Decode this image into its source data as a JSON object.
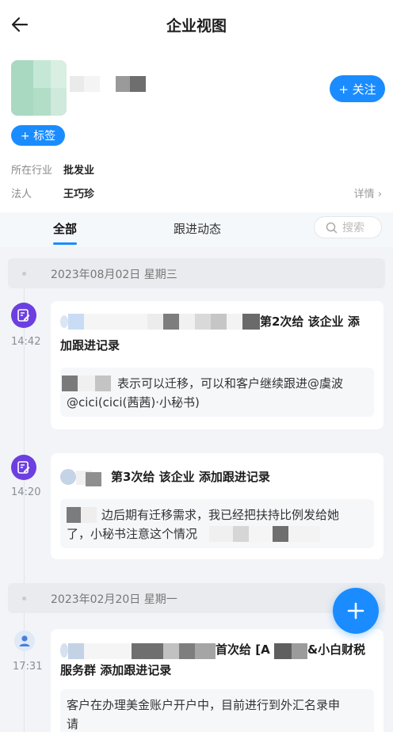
{
  "header": {
    "title": "企业视图"
  },
  "company": {
    "follow_label": "+ 关注",
    "tag_label": "+ 标签",
    "industry_label": "所在行业",
    "industry_value": "批发业",
    "legal_label": "法人",
    "legal_value": "王巧珍",
    "details_label": "详情 ›"
  },
  "tabs": {
    "all": "全部",
    "followup": "跟进动态",
    "search_placeholder": "搜索"
  },
  "feed": {
    "groups": [
      {
        "date": "2023年08月02日  星期三",
        "events": [
          {
            "time": "14:42",
            "title_visible_end": "第2次给  该企业 添加跟进记录",
            "title_line1": "第2次给  该企业  添",
            "title_line2": "加跟进记录",
            "body_line1": "表示可以迁移，可以和客户继续跟进@虞波",
            "body_line2": "@cici(cici(茜茜)·小秘书)"
          },
          {
            "time": "14:20",
            "title_line1": "第3次给  该企业 添加跟进记录",
            "body_line1": "边后期有迁移需求，我已经把扶持比例发给她",
            "body_line2": "了，小秘书注意这个情况"
          }
        ]
      },
      {
        "date": "2023年02月20日  星期一",
        "events": [
          {
            "time": "17:31",
            "title_line1_mid": "首次给 [A",
            "title_line1_end": "&小白财税",
            "title_line2": "服务群  添加跟进记录",
            "body_line1": "客户在办理美金账户开户中，目前进行到外汇名录申",
            "body_line2": "请"
          }
        ]
      }
    ]
  },
  "colors": {
    "accent": "#1a8cff",
    "event_icon": "#6d3fe0"
  },
  "icons": [
    "back-arrow-icon",
    "search-icon",
    "edit-note-icon",
    "user-avatar-icon",
    "plus-icon",
    "chevron-right-icon"
  ]
}
